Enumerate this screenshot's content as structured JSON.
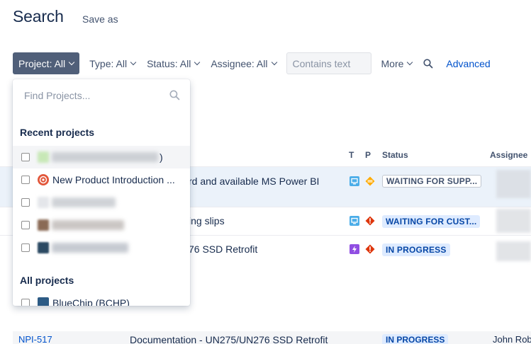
{
  "header": {
    "title": "Search",
    "save_as": "Save as"
  },
  "filters": {
    "project": "Project: All",
    "type": "Type: All",
    "status": "Status: All",
    "assignee": "Assignee: All",
    "contains_placeholder": "Contains text",
    "more": "More",
    "advanced": "Advanced"
  },
  "table": {
    "headers": {
      "t": "T",
      "p": "P",
      "status": "Status",
      "assignee": "Assignee"
    },
    "rows": [
      {
        "summary": "rd and available MS Power BI",
        "status": "WAITING FOR SUPP...",
        "type_icon": "monitor-icon",
        "priority_icon": "medium-priority-icon"
      },
      {
        "summary": "ing slips",
        "status": "WAITING FOR CUST...",
        "type_icon": "monitor-icon",
        "priority_icon": "high-priority-icon"
      },
      {
        "summary": "76 SSD Retrofit",
        "status": "IN PROGRESS",
        "type_icon": "lightning-icon",
        "priority_icon": "high-priority-icon"
      }
    ],
    "bottom_row": {
      "key": "NPI-517",
      "summary": "Documentation - UN275/UN276 SSD Retrofit",
      "status": "IN PROGRESS",
      "assignee": "John Rob"
    }
  },
  "dropdown": {
    "search_placeholder": "Find Projects...",
    "recent_heading": "Recent projects",
    "recent_projects": [
      {
        "label": ")",
        "redacted": true
      },
      {
        "label": "New Product Introduction ...",
        "redacted": false
      },
      {
        "label": "",
        "redacted": true
      },
      {
        "label": "",
        "redacted": true
      },
      {
        "label": "",
        "redacted": true
      }
    ],
    "all_heading": "All projects",
    "all_projects": [
      {
        "label": "BlueChip (BCHP)"
      }
    ]
  },
  "colors": {
    "active_filter_bg": "#505f79",
    "link": "#0052cc",
    "highlight_row": "#ebf2fa",
    "status_blue_bg": "#deebff",
    "status_blue_text": "#0747a6"
  }
}
